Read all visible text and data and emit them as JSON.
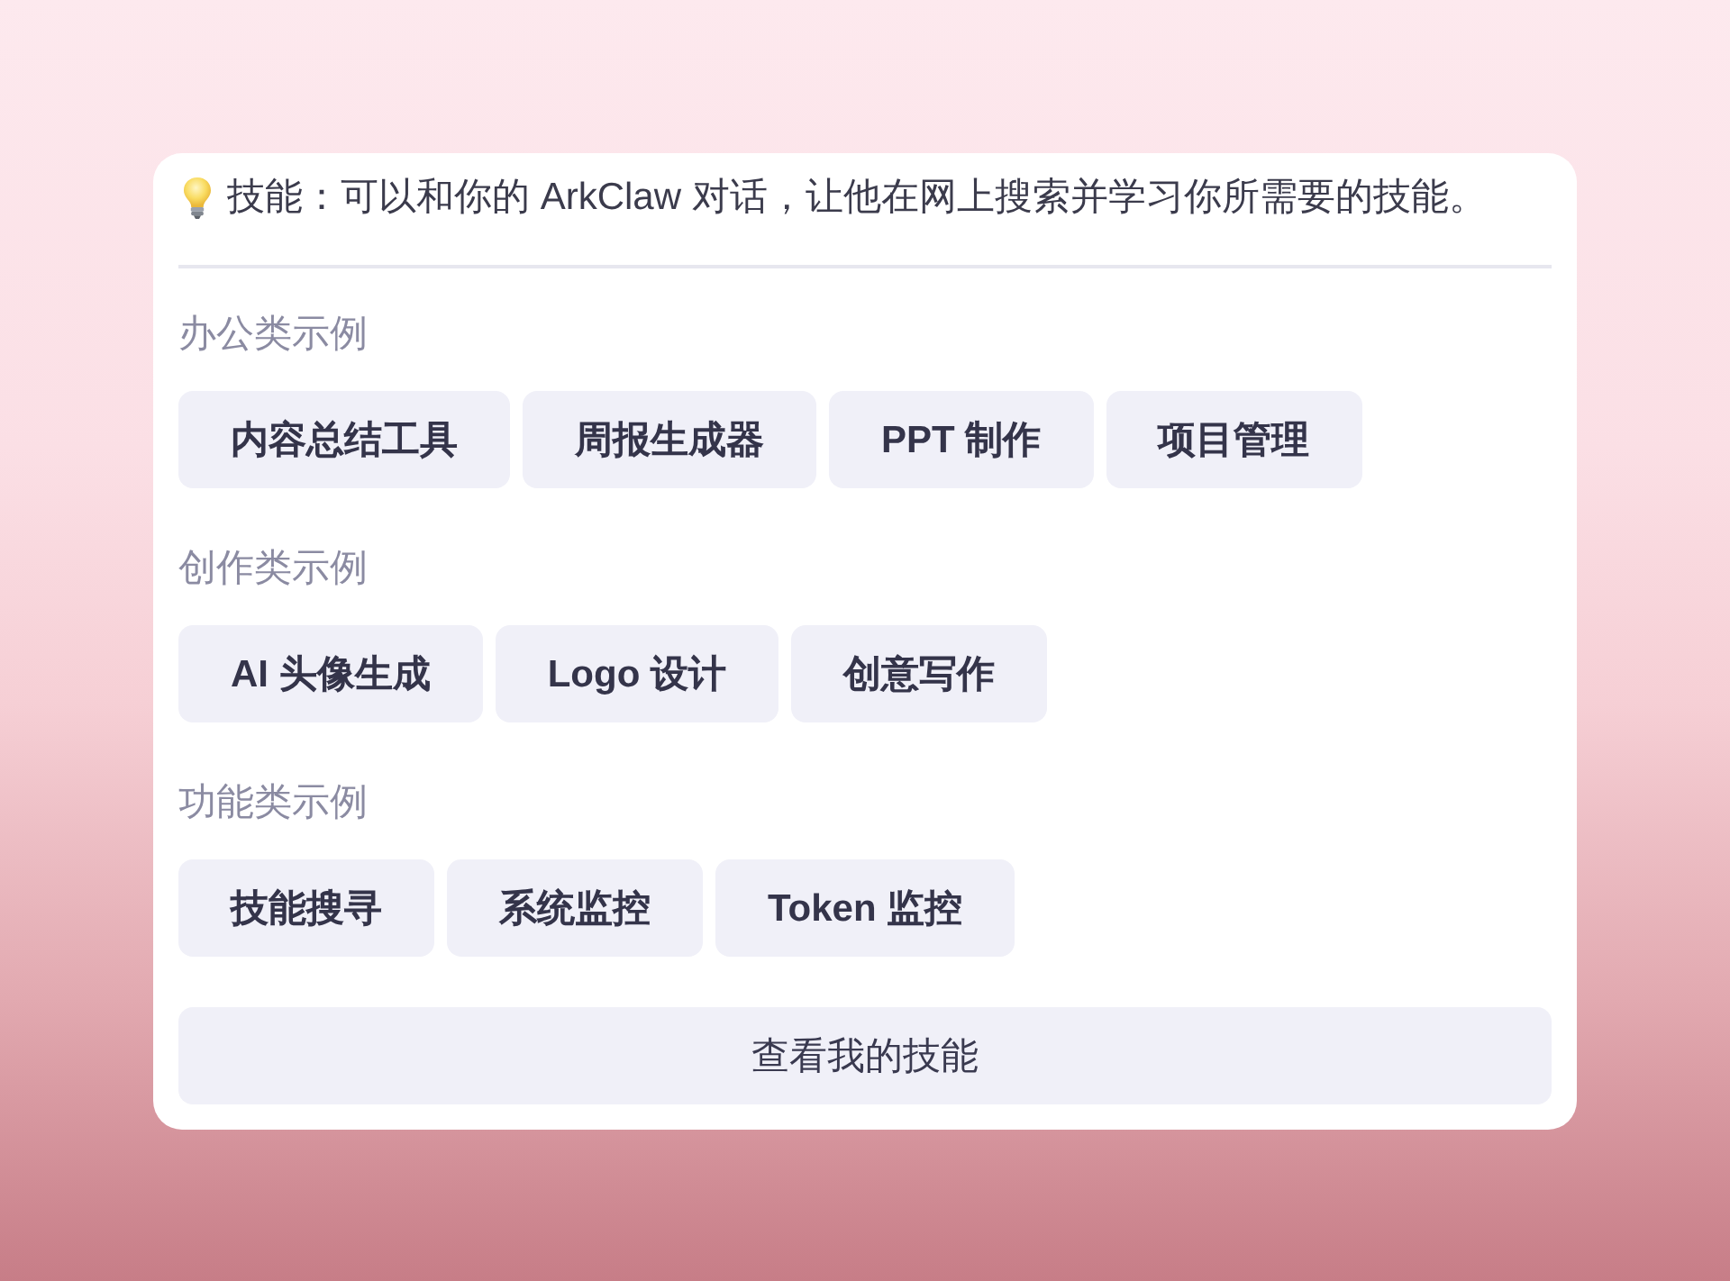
{
  "intro": {
    "text": "技能：可以和你的 ArkClaw 对话，让他在网上搜索并学习你所需要的技能。"
  },
  "sections": [
    {
      "heading": "办公类示例",
      "examples": [
        "内容总结工具",
        "周报生成器",
        "PPT 制作",
        "项目管理"
      ]
    },
    {
      "heading": "创作类示例",
      "examples": [
        "AI 头像生成",
        "Logo 设计",
        "创意写作"
      ]
    },
    {
      "heading": "功能类示例",
      "examples": [
        "技能搜寻",
        "系统监控",
        "Token 监控"
      ]
    }
  ],
  "footer_button": {
    "label": "查看我的技能"
  }
}
